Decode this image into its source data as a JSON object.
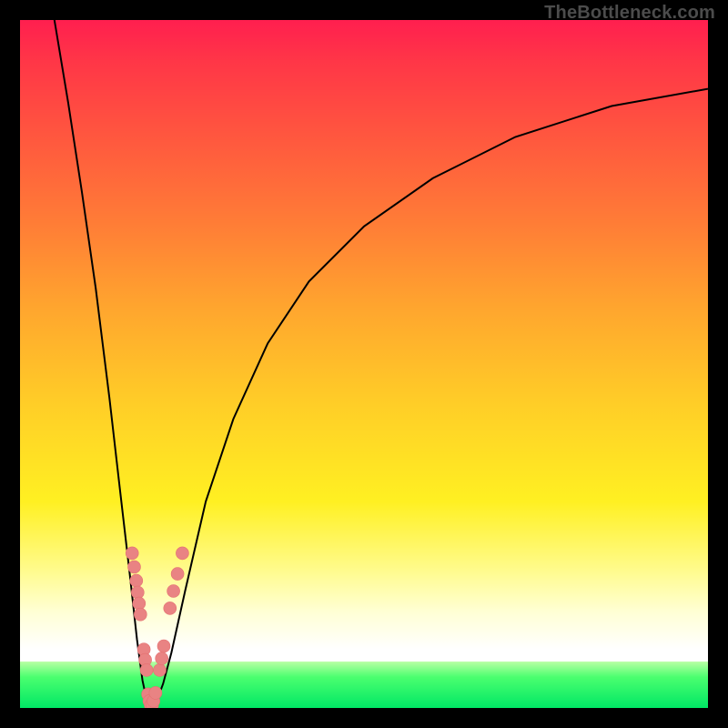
{
  "watermark": "TheBottleneck.com",
  "colors": {
    "frame": "#000000",
    "gradient_top": "#ff1f4f",
    "gradient_mid": "#ffd028",
    "gradient_white": "#ffffff",
    "gradient_green": "#00e765",
    "curve": "#000000",
    "dot_fill": "#e98383"
  },
  "chart_data": {
    "type": "line",
    "title": "",
    "xlabel": "",
    "ylabel": "",
    "xlim": [
      0,
      100
    ],
    "ylim": [
      0,
      100
    ],
    "series": [
      {
        "name": "left-branch",
        "x": [
          5,
          7,
          9,
          11,
          13,
          14.5,
          16,
          17,
          17.8,
          18.4,
          18.8,
          19.0
        ],
        "y": [
          100,
          88,
          75,
          61,
          45,
          32,
          19,
          10,
          4,
          1.2,
          0.3,
          0
        ]
      },
      {
        "name": "right-branch",
        "x": [
          19.0,
          19.4,
          20.0,
          20.8,
          22,
          24,
          27,
          31,
          36,
          42,
          50,
          60,
          72,
          86,
          100
        ],
        "y": [
          0,
          0.4,
          1.4,
          3.5,
          8,
          17,
          30,
          42,
          53,
          62,
          70,
          77,
          83,
          87.5,
          90
        ]
      }
    ],
    "minimum": {
      "x": 19.0,
      "y": 0
    },
    "dot_clusters": [
      {
        "name": "left-cluster-upper",
        "points": [
          [
            16.3,
            22.5
          ],
          [
            16.6,
            20.5
          ],
          [
            16.9,
            18.5
          ],
          [
            17.1,
            16.8
          ],
          [
            17.3,
            15.2
          ],
          [
            17.5,
            13.6
          ]
        ]
      },
      {
        "name": "left-cluster-lower",
        "points": [
          [
            18.0,
            8.5
          ],
          [
            18.2,
            7.0
          ],
          [
            18.4,
            5.5
          ]
        ]
      },
      {
        "name": "valley",
        "points": [
          [
            18.6,
            2.0
          ],
          [
            18.8,
            1.0
          ],
          [
            19.0,
            0.4
          ],
          [
            19.2,
            0.4
          ],
          [
            19.4,
            1.0
          ],
          [
            19.7,
            2.2
          ]
        ]
      },
      {
        "name": "right-cluster-lower",
        "points": [
          [
            20.3,
            5.5
          ],
          [
            20.6,
            7.2
          ],
          [
            20.9,
            9.0
          ]
        ]
      },
      {
        "name": "right-cluster-upper",
        "points": [
          [
            21.8,
            14.5
          ],
          [
            22.3,
            17.0
          ],
          [
            22.9,
            19.5
          ],
          [
            23.6,
            22.5
          ]
        ]
      }
    ]
  }
}
